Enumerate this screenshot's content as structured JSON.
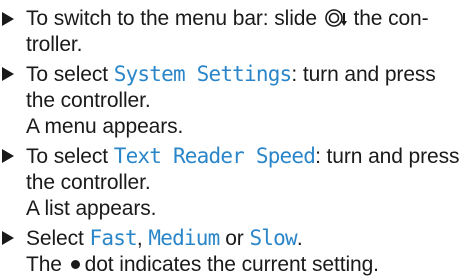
{
  "steps": [
    {
      "before": "To switch to the menu bar: slide",
      "icon": "controller-slide-down-icon",
      "after": "the con-troller."
    },
    {
      "before": "To select",
      "keyword": "System Settings",
      "after": ": turn and press the controller.",
      "result": "A menu appears."
    },
    {
      "before": "To select",
      "keyword": "Text Reader Speed",
      "after": ": turn and press the controller.",
      "result": "A list appears."
    },
    {
      "before": "Select",
      "option1": "Fast",
      "sep1": ",",
      "option2": "Medium",
      "sep2": "or",
      "option3": "Slow",
      "end": ".",
      "result_before": "The",
      "result_icon": "bullet-dot-icon",
      "result_after": "dot indicates the current setting."
    }
  ],
  "colors": {
    "text": "#1a1a1a",
    "keyword": "#2a86c8"
  }
}
